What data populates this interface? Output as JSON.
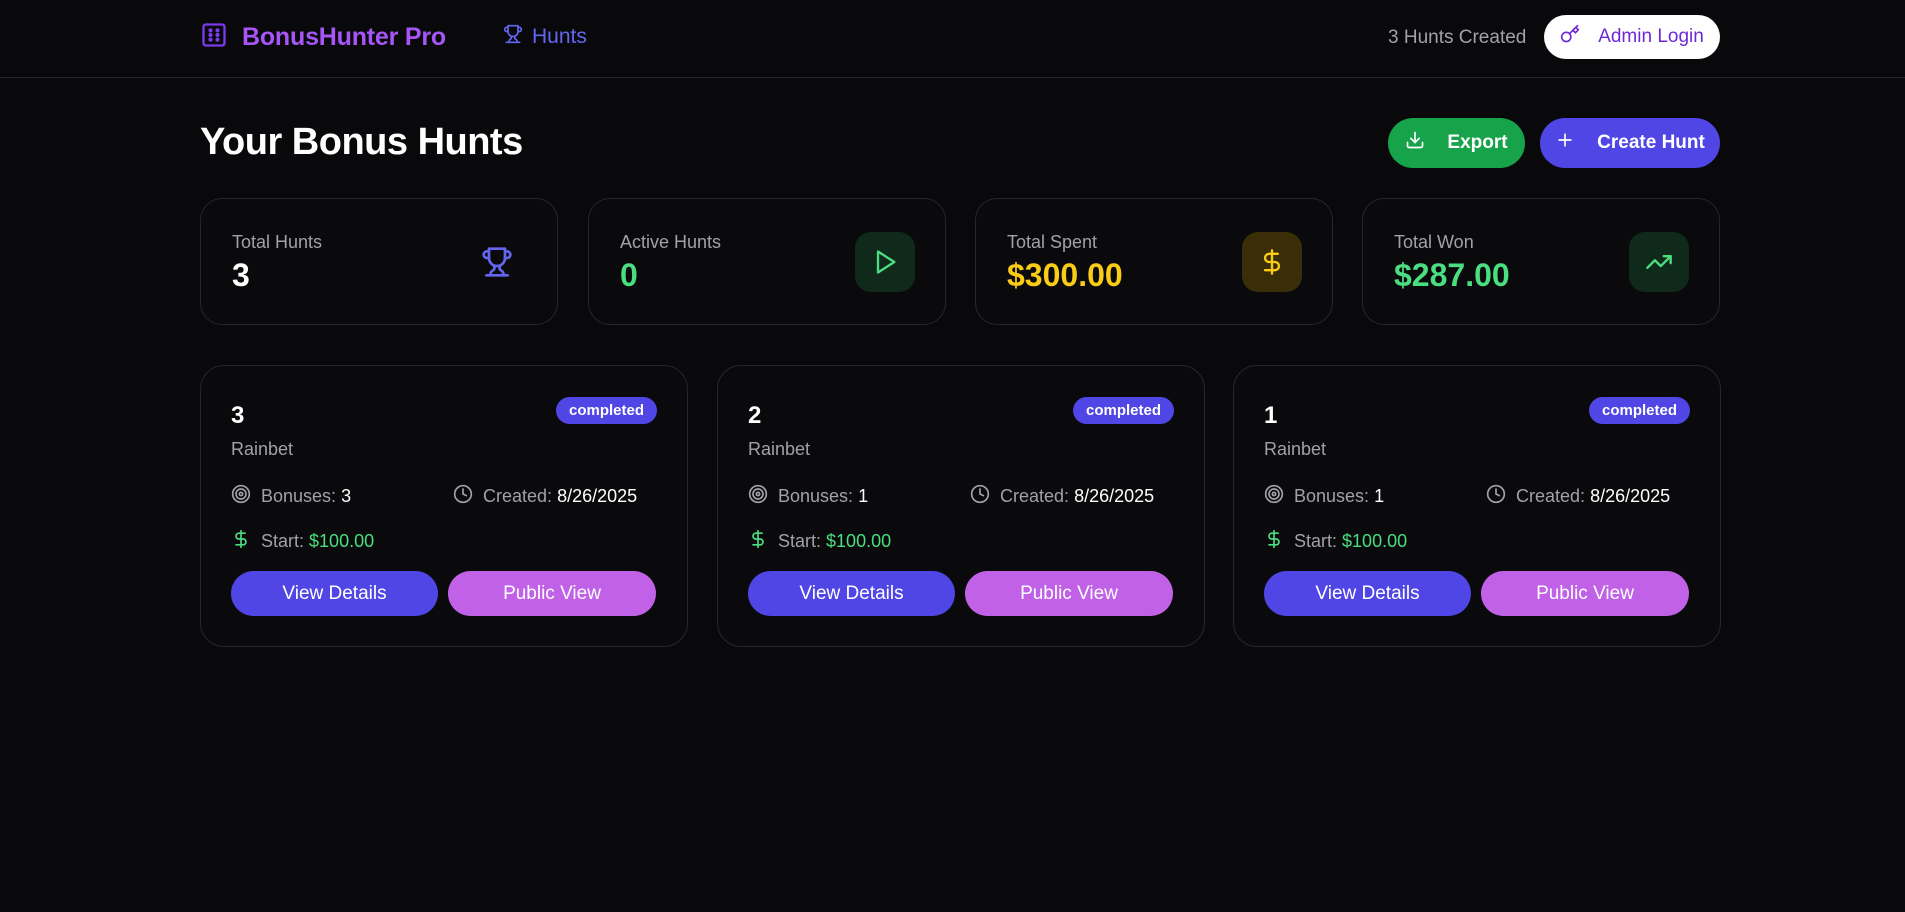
{
  "header": {
    "brand": "BonusHunter Pro",
    "nav_hunts": "Hunts",
    "hunt_count_text": "3 Hunts Created",
    "admin_login": "Admin Login"
  },
  "page": {
    "title": "Your Bonus Hunts",
    "export_label": "Export",
    "create_label": "Create Hunt"
  },
  "stats": [
    {
      "label": "Total Hunts",
      "value": "3",
      "icon": "trophy-icon",
      "color": "#ffffff"
    },
    {
      "label": "Active Hunts",
      "value": "0",
      "icon": "play-icon",
      "color": "#4ade80"
    },
    {
      "label": "Total Spent",
      "value": "$300.00",
      "icon": "dollar-icon",
      "color": "#facc15"
    },
    {
      "label": "Total Won",
      "value": "$287.00",
      "icon": "trending-up-icon",
      "color": "#4ade80"
    }
  ],
  "hunts": [
    {
      "name": "3",
      "status": "completed",
      "casino": "Rainbet",
      "bonuses_label": "Bonuses:",
      "bonuses": "3",
      "created_label": "Created:",
      "created": "8/26/2025",
      "start_label": "Start:",
      "start": "$100.00",
      "view_label": "View Details",
      "public_label": "Public View"
    },
    {
      "name": "2",
      "status": "completed",
      "casino": "Rainbet",
      "bonuses_label": "Bonuses:",
      "bonuses": "1",
      "created_label": "Created:",
      "created": "8/26/2025",
      "start_label": "Start:",
      "start": "$100.00",
      "view_label": "View Details",
      "public_label": "Public View"
    },
    {
      "name": "1",
      "status": "completed",
      "casino": "Rainbet",
      "bonuses_label": "Bonuses:",
      "bonuses": "1",
      "created_label": "Created:",
      "created": "8/26/2025",
      "start_label": "Start:",
      "start": "$100.00",
      "view_label": "View Details",
      "public_label": "Public View"
    }
  ],
  "colors": {
    "background": "#09090b",
    "accent": "#4f46e5",
    "brand": "#a855f7",
    "success": "#16a34a",
    "public": "#c061e8",
    "warning": "#facc15"
  }
}
